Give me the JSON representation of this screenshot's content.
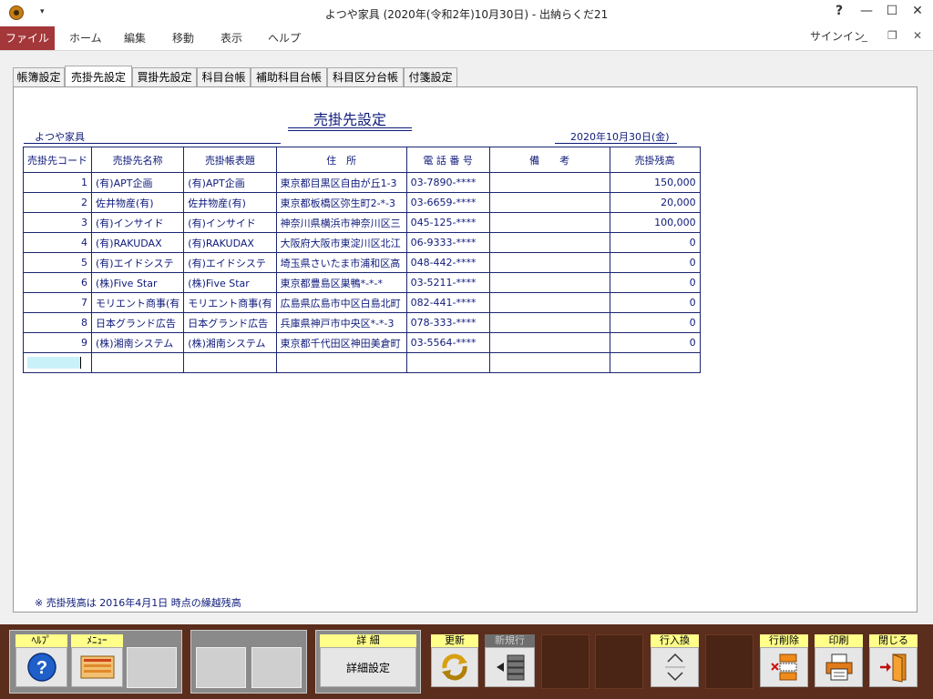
{
  "window": {
    "title": "よつや家具 (2020年(令和2年)10月30日) - 出納らくだ21",
    "help_label": "?"
  },
  "ribbon": {
    "file": "ファイル",
    "items": [
      "ホーム",
      "編集",
      "移動",
      "表示",
      "ヘルプ"
    ],
    "signin": "サインイン"
  },
  "tabs": [
    "帳簿設定",
    "売掛先設定",
    "買掛先設定",
    "科目台帳",
    "補助科目台帳",
    "科目区分台帳",
    "付箋設定"
  ],
  "active_tab": "売掛先設定",
  "sheet": {
    "title": "売掛先設定",
    "company": "よつや家具",
    "date": "2020年10月30日(金)",
    "columns": [
      "売掛先コード",
      "売掛先名称",
      "売掛帳表題",
      "住　所",
      "電 話 番 号",
      "備　　考",
      "売掛残高"
    ],
    "rows": [
      {
        "code": "1",
        "name": "(有)APT企画",
        "ledger": "(有)APT企画",
        "address": "東京都目黒区自由が丘1-3",
        "phone": "03-7890-****",
        "note": "",
        "balance": "150,000"
      },
      {
        "code": "2",
        "name": "佐井物産(有)",
        "ledger": "佐井物産(有)",
        "address": "東京都板橋区弥生町2-*-3",
        "phone": "03-6659-****",
        "note": "",
        "balance": "20,000"
      },
      {
        "code": "3",
        "name": "(有)インサイド",
        "ledger": "(有)インサイド",
        "address": "神奈川県横浜市神奈川区三",
        "phone": "045-125-****",
        "note": "",
        "balance": "100,000"
      },
      {
        "code": "4",
        "name": "(有)RAKUDAX",
        "ledger": "(有)RAKUDAX",
        "address": "大阪府大阪市東淀川区北江",
        "phone": "06-9333-****",
        "note": "",
        "balance": "0"
      },
      {
        "code": "5",
        "name": "(有)エイドシステ",
        "ledger": "(有)エイドシステ",
        "address": "埼玉県さいたま市浦和区高",
        "phone": "048-442-****",
        "note": "",
        "balance": "0"
      },
      {
        "code": "6",
        "name": "(株)Five Star",
        "ledger": "(株)Five Star",
        "address": "東京都豊島区巣鴨*-*-*",
        "phone": "03-5211-****",
        "note": "",
        "balance": "0"
      },
      {
        "code": "7",
        "name": "モリエント商事(有",
        "ledger": "モリエント商事(有",
        "address": "広島県広島市中区白島北町",
        "phone": "082-441-****",
        "note": "",
        "balance": "0"
      },
      {
        "code": "8",
        "name": "日本グランド広告",
        "ledger": "日本グランド広告",
        "address": "兵庫県神戸市中央区*-*-3",
        "phone": "078-333-****",
        "note": "",
        "balance": "0"
      },
      {
        "code": "9",
        "name": "(株)湘南システム",
        "ledger": "(株)湘南システム",
        "address": "東京都千代田区神田美倉町",
        "phone": "03-5564-****",
        "note": "",
        "balance": "0"
      }
    ],
    "footnote": "※ 売掛残高は 2016年4月1日 時点の繰越残高"
  },
  "footer": {
    "help": "ﾍﾙﾌﾟ",
    "menu": "ﾒﾆｭｰ",
    "detail_label": "詳 細",
    "detail_button": "詳細設定",
    "update": "更新",
    "new_row": "新規行",
    "row_swap": "行入換",
    "row_delete": "行削除",
    "print": "印刷",
    "close": "閉じる"
  },
  "colors": {
    "file_tab": "#a4373a",
    "table_text": "#0e1a7a",
    "footer_bg": "#5b2d1c",
    "label_bg": "#ffff8a"
  }
}
